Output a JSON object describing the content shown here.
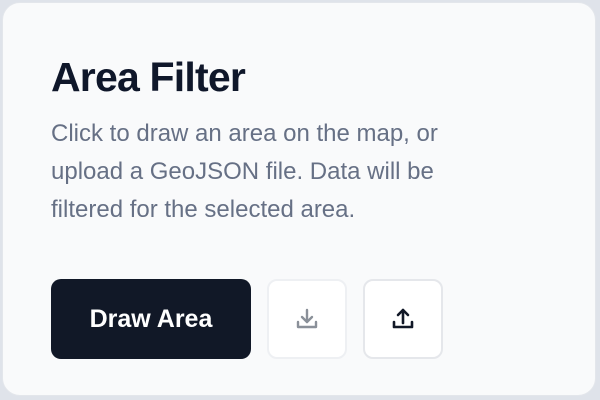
{
  "panel": {
    "title": "Area Filter",
    "description": "Click to draw an area on the map, or\nupload a GeoJSON file. Data will be\nfiltered for the selected area."
  },
  "actions": {
    "draw_label": "Draw Area",
    "download_icon": "download-icon",
    "upload_icon": "upload-icon"
  },
  "colors": {
    "primary_button_bg": "#111827",
    "primary_button_text": "#ffffff",
    "title_text": "#0f172a",
    "description_text": "#667085",
    "card_bg": "#f9fafb",
    "disabled_icon": "#8a9099",
    "enabled_icon": "#111827"
  }
}
